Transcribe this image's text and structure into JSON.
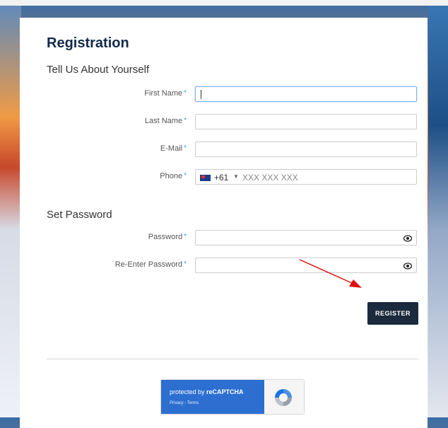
{
  "form": {
    "title": "Registration",
    "about_heading": "Tell Us About Yourself",
    "password_heading": "Set Password",
    "fields": {
      "first_name": {
        "label": "First Name",
        "value": ""
      },
      "last_name": {
        "label": "Last Name",
        "value": ""
      },
      "email": {
        "label": "E-Mail",
        "value": ""
      },
      "phone": {
        "label": "Phone",
        "country_code": "+61",
        "placeholder": "XXX XXX XXX"
      },
      "password": {
        "label": "Password",
        "value": ""
      },
      "reenter_password": {
        "label": "Re-Enter Password",
        "value": ""
      }
    },
    "required_marker": "*",
    "register_label": "REGISTER"
  },
  "recaptcha": {
    "protected_prefix": "protected by ",
    "brand": "reCAPTCHA",
    "links": "Privacy - Terms"
  }
}
